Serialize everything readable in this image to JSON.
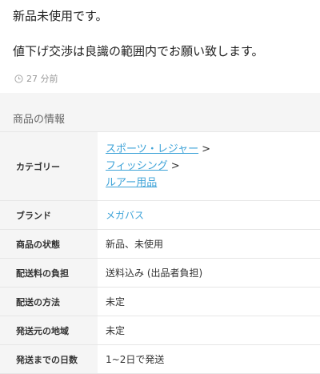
{
  "description": {
    "line1": "新品未使用です。",
    "line2": "値下げ交渉は良識の範囲内でお願い致します。"
  },
  "posted_time": "27 分前",
  "section_title": "商品の情報",
  "info": {
    "category": {
      "label": "カテゴリー",
      "path": [
        "スポーツ・レジャー",
        "フィッシング",
        "ルアー用品"
      ],
      "separator": ">"
    },
    "brand": {
      "label": "ブランド",
      "value": "メガバス"
    },
    "condition": {
      "label": "商品の状態",
      "value": "新品、未使用"
    },
    "shipping_fee": {
      "label": "配送料の負担",
      "value": "送料込み (出品者負担)"
    },
    "shipping_method": {
      "label": "配送の方法",
      "value": "未定"
    },
    "ship_from": {
      "label": "発送元の地域",
      "value": "未定"
    },
    "ship_days": {
      "label": "発送までの日数",
      "value": "1~2日で発送"
    }
  },
  "colors": {
    "link": "#3ea3d8",
    "label_bg": "#f5f5f5",
    "border": "#e6e6e6",
    "muted_text": "#999999"
  },
  "icons": {
    "time": "clock-icon"
  }
}
